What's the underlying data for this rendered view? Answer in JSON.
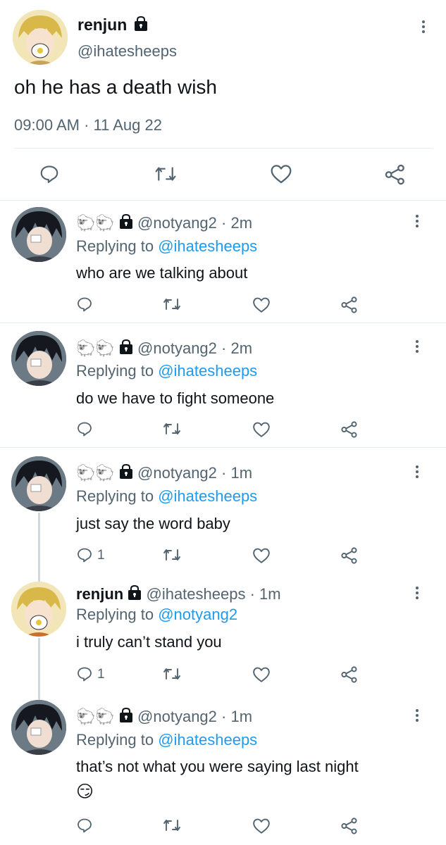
{
  "main_tweet": {
    "display_name": "renjun",
    "handle": "@ihatesheeps",
    "text": "oh he has a death wish",
    "timestamp": "09:00 AM · 11 Aug 22",
    "protected_icon": "lock-icon",
    "actions": [
      "reply-icon",
      "retweet-icon",
      "like-icon",
      "share-icon"
    ]
  },
  "replies": [
    {
      "display_name": "🐑🐑",
      "handle": "@notyang2",
      "time": "2m",
      "replying_label": "Replying to",
      "replying_to": "@ihatesheeps",
      "text": "who are we talking about",
      "reply_count": ""
    },
    {
      "display_name": "🐑🐑",
      "handle": "@notyang2",
      "time": "2m",
      "replying_label": "Replying to",
      "replying_to": "@ihatesheeps",
      "text": "do we have to fight someone",
      "reply_count": ""
    },
    {
      "display_name": "🐑🐑",
      "handle": "@notyang2",
      "time": "1m",
      "replying_label": "Replying to",
      "replying_to": "@ihatesheeps",
      "text": "just say the word baby",
      "reply_count": "1"
    },
    {
      "display_name": "renjun",
      "handle": "@ihatesheeps",
      "time": "1m",
      "replying_label": "Replying to",
      "replying_to": "@notyang2",
      "text": "i truly can’t stand you",
      "reply_count": "1"
    },
    {
      "display_name": "🐑🐑",
      "handle": "@notyang2",
      "time": "1m",
      "replying_label": "Replying to",
      "replying_to": "@ihatesheeps",
      "text": "that’s not what you were saying last night",
      "text_line2": "😏",
      "reply_count": ""
    }
  ],
  "separator": " · ",
  "colors": {
    "text": "#0f1419",
    "secondary": "#536471",
    "link": "#1d9bf0",
    "divider": "#e6ecf0"
  }
}
